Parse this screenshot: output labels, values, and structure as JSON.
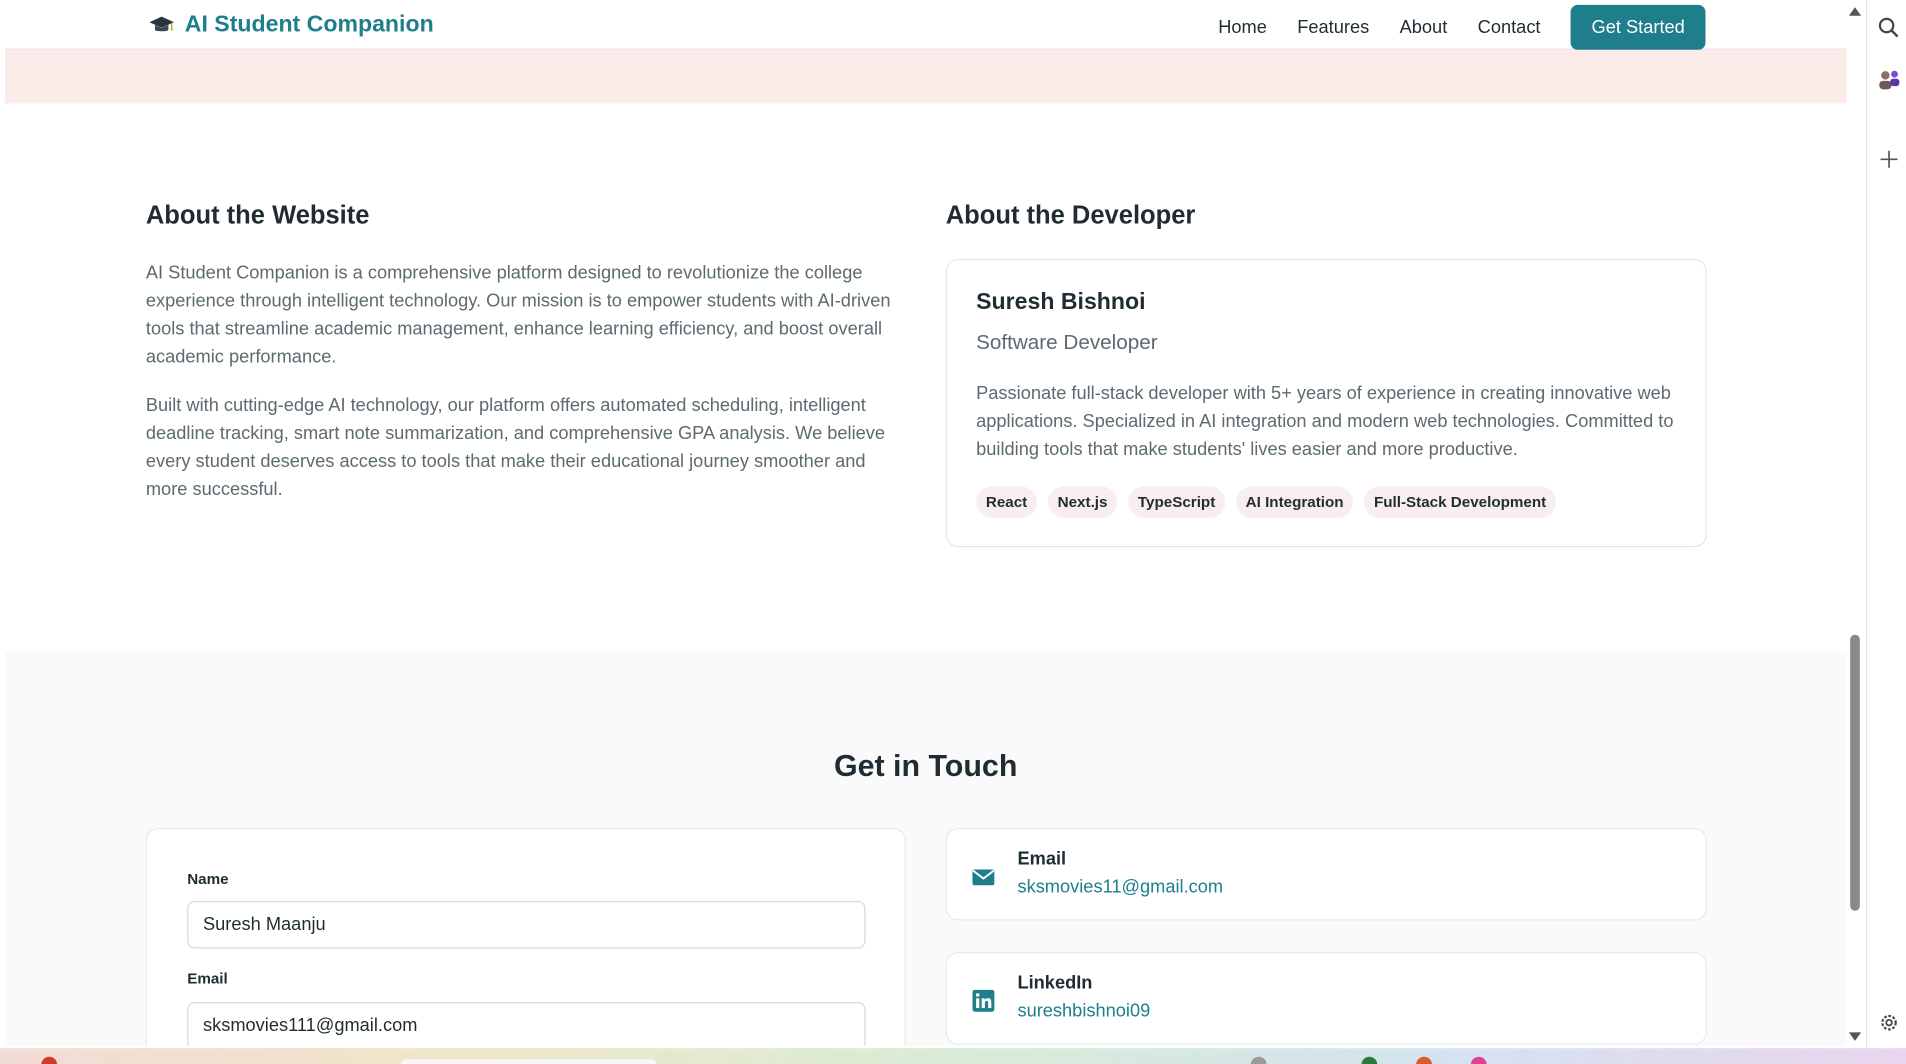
{
  "navbar": {
    "brand": "AI Student Companion",
    "links": [
      "Home",
      "Features",
      "About",
      "Contact"
    ],
    "cta": "Get Started"
  },
  "about_website": {
    "title": "About the Website",
    "paragraphs": [
      "AI Student Companion is a comprehensive platform designed to revolutionize the college experience through intelligent technology. Our mission is to empower students with AI-driven tools that streamline academic management, enhance learning efficiency, and boost overall academic performance.",
      "Built with cutting-edge AI technology, our platform offers automated scheduling, intelligent deadline tracking, smart note summarization, and comprehensive GPA analysis. We believe every student deserves access to tools that make their educational journey smoother and more successful."
    ]
  },
  "about_developer": {
    "title": "About the Developer",
    "name": "Suresh Bishnoi",
    "role": "Software Developer",
    "bio": "Passionate full-stack developer with 5+ years of experience in creating innovative web applications. Specialized in AI integration and modern web technologies. Committed to building tools that make students' lives easier and more productive.",
    "skills": [
      "React",
      "Next.js",
      "TypeScript",
      "AI Integration",
      "Full-Stack Development"
    ]
  },
  "contact": {
    "title": "Get in Touch",
    "form": {
      "name_label": "Name",
      "name_value": "Suresh Maanju",
      "email_label": "Email",
      "email_value": "sksmovies111@gmail.com"
    },
    "cards": [
      {
        "title": "Email",
        "value": "sksmovies11@gmail.com",
        "icon": "envelope-icon"
      },
      {
        "title": "LinkedIn",
        "value": "sureshbishnoi09",
        "icon": "linkedin-icon"
      }
    ]
  },
  "colors": {
    "accent": "#1e7e8c",
    "band": "#fbecea",
    "tag_bg": "#f8eeee"
  }
}
